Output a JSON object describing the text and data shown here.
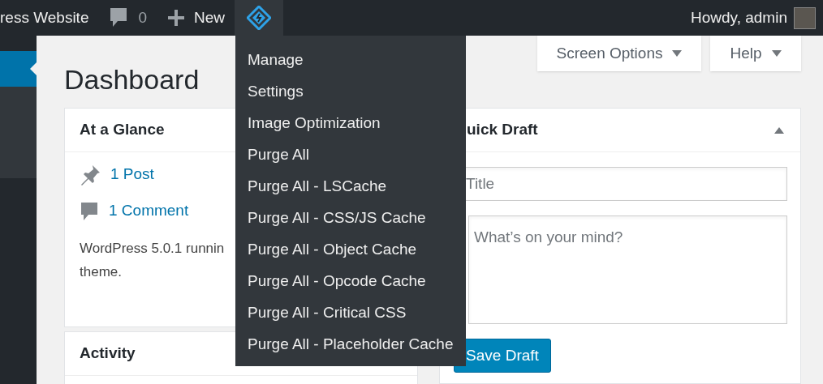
{
  "admin_bar": {
    "site_name": "ress Website",
    "comments_count": "0",
    "new_label": "New",
    "plugin_menu_open": true,
    "greeting": "Howdy, admin"
  },
  "plugin_menu": {
    "items": [
      {
        "label": "Manage"
      },
      {
        "label": "Settings"
      },
      {
        "label": "Image Optimization"
      },
      {
        "label": "Purge All"
      },
      {
        "label": "Purge All - LSCache"
      },
      {
        "label": "Purge All - CSS/JS Cache"
      },
      {
        "label": "Purge All - Object Cache"
      },
      {
        "label": "Purge All - Opcode Cache"
      },
      {
        "label": "Purge All - Critical CSS"
      },
      {
        "label": "Purge All - Placeholder Cache"
      }
    ]
  },
  "page_title": "Dashboard",
  "screen_options": "Screen Options",
  "help": "Help",
  "at_a_glance": {
    "title": "At a Glance",
    "items": [
      {
        "kind": "post",
        "label": "1 Post"
      },
      {
        "kind": "comment",
        "label": "1 Comment"
      }
    ],
    "text_lines": [
      "WordPress 5.0.1 runnin",
      "theme."
    ]
  },
  "activity": {
    "title": "Activity"
  },
  "quick_draft": {
    "title": "uick Draft",
    "title_placeholder": "Title",
    "content_placeholder": "What’s on your mind?",
    "save_button": "Save Draft"
  }
}
